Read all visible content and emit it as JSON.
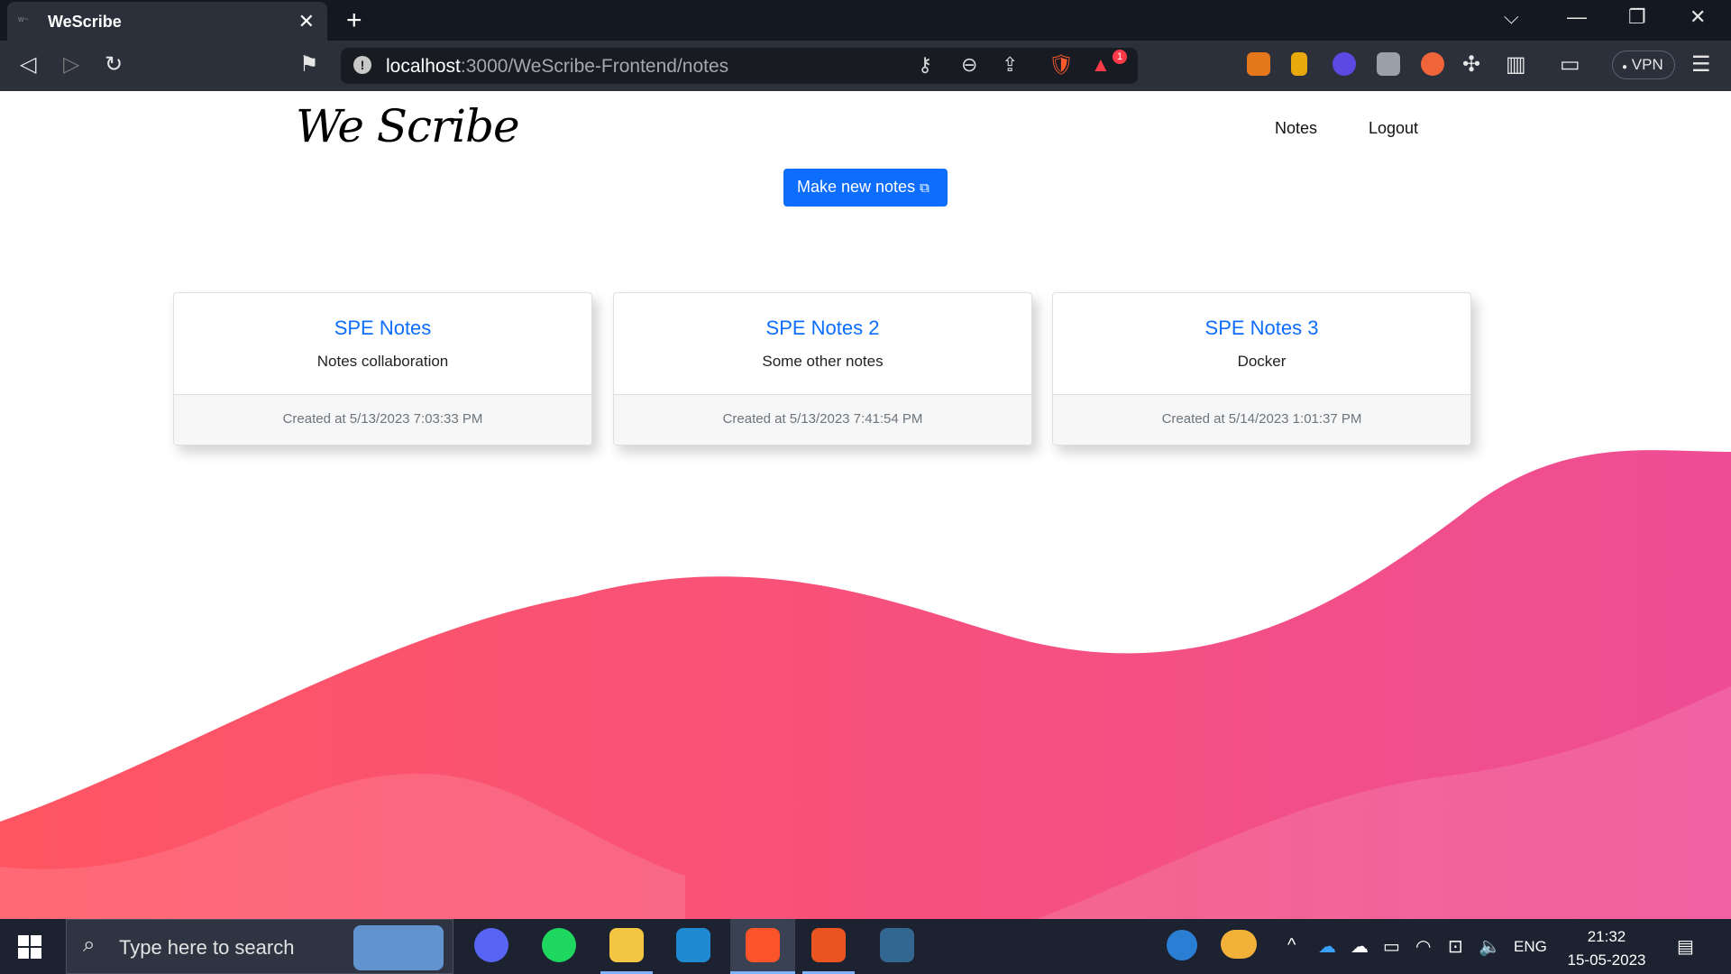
{
  "browser": {
    "tab_title": "WeScribe",
    "url_host": "localhost",
    "url_rest": ":3000/WeScribe-Frontend/notes",
    "vpn_label": "VPN",
    "notification_count": "1"
  },
  "page": {
    "logo_text": "We Scribe",
    "nav": {
      "notes": "Notes",
      "logout": "Logout"
    },
    "make_button": "Make new notes",
    "notes": [
      {
        "title": "SPE Notes",
        "description": "Notes collaboration",
        "created": "Created at 5/13/2023 7:03:33 PM"
      },
      {
        "title": "SPE Notes 2",
        "description": "Some other notes",
        "created": "Created at 5/13/2023 7:41:54 PM"
      },
      {
        "title": "SPE Notes 3",
        "description": "Docker",
        "created": "Created at 5/14/2023 1:01:37 PM"
      }
    ]
  },
  "taskbar": {
    "search_placeholder": "Type here to search",
    "language": "ENG",
    "time": "21:32",
    "date": "15-05-2023"
  },
  "colors": {
    "accent": "#0d6efd",
    "wave_start": "#ff5562",
    "wave_end": "#ee4d95",
    "browser_bg": "#2b303b"
  }
}
